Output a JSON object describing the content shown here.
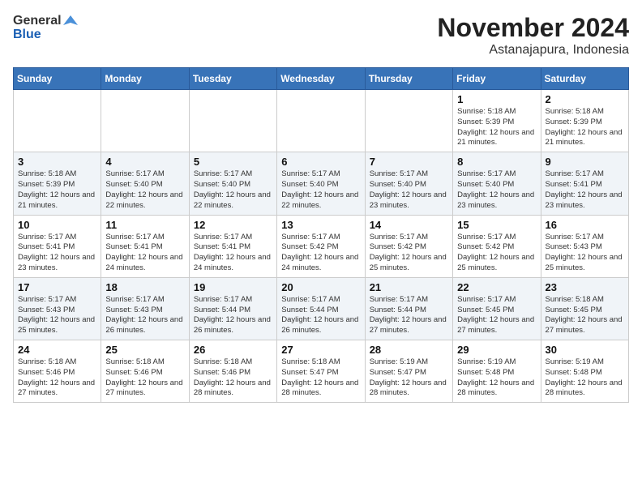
{
  "header": {
    "logo_general": "General",
    "logo_blue": "Blue",
    "title": "November 2024",
    "subtitle": "Astanajapura, Indonesia"
  },
  "calendar": {
    "days_of_week": [
      "Sunday",
      "Monday",
      "Tuesday",
      "Wednesday",
      "Thursday",
      "Friday",
      "Saturday"
    ],
    "weeks": [
      [
        {
          "day": "",
          "info": ""
        },
        {
          "day": "",
          "info": ""
        },
        {
          "day": "",
          "info": ""
        },
        {
          "day": "",
          "info": ""
        },
        {
          "day": "",
          "info": ""
        },
        {
          "day": "1",
          "info": "Sunrise: 5:18 AM\nSunset: 5:39 PM\nDaylight: 12 hours and 21 minutes."
        },
        {
          "day": "2",
          "info": "Sunrise: 5:18 AM\nSunset: 5:39 PM\nDaylight: 12 hours and 21 minutes."
        }
      ],
      [
        {
          "day": "3",
          "info": "Sunrise: 5:18 AM\nSunset: 5:39 PM\nDaylight: 12 hours and 21 minutes."
        },
        {
          "day": "4",
          "info": "Sunrise: 5:17 AM\nSunset: 5:40 PM\nDaylight: 12 hours and 22 minutes."
        },
        {
          "day": "5",
          "info": "Sunrise: 5:17 AM\nSunset: 5:40 PM\nDaylight: 12 hours and 22 minutes."
        },
        {
          "day": "6",
          "info": "Sunrise: 5:17 AM\nSunset: 5:40 PM\nDaylight: 12 hours and 22 minutes."
        },
        {
          "day": "7",
          "info": "Sunrise: 5:17 AM\nSunset: 5:40 PM\nDaylight: 12 hours and 23 minutes."
        },
        {
          "day": "8",
          "info": "Sunrise: 5:17 AM\nSunset: 5:40 PM\nDaylight: 12 hours and 23 minutes."
        },
        {
          "day": "9",
          "info": "Sunrise: 5:17 AM\nSunset: 5:41 PM\nDaylight: 12 hours and 23 minutes."
        }
      ],
      [
        {
          "day": "10",
          "info": "Sunrise: 5:17 AM\nSunset: 5:41 PM\nDaylight: 12 hours and 23 minutes."
        },
        {
          "day": "11",
          "info": "Sunrise: 5:17 AM\nSunset: 5:41 PM\nDaylight: 12 hours and 24 minutes."
        },
        {
          "day": "12",
          "info": "Sunrise: 5:17 AM\nSunset: 5:41 PM\nDaylight: 12 hours and 24 minutes."
        },
        {
          "day": "13",
          "info": "Sunrise: 5:17 AM\nSunset: 5:42 PM\nDaylight: 12 hours and 24 minutes."
        },
        {
          "day": "14",
          "info": "Sunrise: 5:17 AM\nSunset: 5:42 PM\nDaylight: 12 hours and 25 minutes."
        },
        {
          "day": "15",
          "info": "Sunrise: 5:17 AM\nSunset: 5:42 PM\nDaylight: 12 hours and 25 minutes."
        },
        {
          "day": "16",
          "info": "Sunrise: 5:17 AM\nSunset: 5:43 PM\nDaylight: 12 hours and 25 minutes."
        }
      ],
      [
        {
          "day": "17",
          "info": "Sunrise: 5:17 AM\nSunset: 5:43 PM\nDaylight: 12 hours and 25 minutes."
        },
        {
          "day": "18",
          "info": "Sunrise: 5:17 AM\nSunset: 5:43 PM\nDaylight: 12 hours and 26 minutes."
        },
        {
          "day": "19",
          "info": "Sunrise: 5:17 AM\nSunset: 5:44 PM\nDaylight: 12 hours and 26 minutes."
        },
        {
          "day": "20",
          "info": "Sunrise: 5:17 AM\nSunset: 5:44 PM\nDaylight: 12 hours and 26 minutes."
        },
        {
          "day": "21",
          "info": "Sunrise: 5:17 AM\nSunset: 5:44 PM\nDaylight: 12 hours and 27 minutes."
        },
        {
          "day": "22",
          "info": "Sunrise: 5:17 AM\nSunset: 5:45 PM\nDaylight: 12 hours and 27 minutes."
        },
        {
          "day": "23",
          "info": "Sunrise: 5:18 AM\nSunset: 5:45 PM\nDaylight: 12 hours and 27 minutes."
        }
      ],
      [
        {
          "day": "24",
          "info": "Sunrise: 5:18 AM\nSunset: 5:46 PM\nDaylight: 12 hours and 27 minutes."
        },
        {
          "day": "25",
          "info": "Sunrise: 5:18 AM\nSunset: 5:46 PM\nDaylight: 12 hours and 27 minutes."
        },
        {
          "day": "26",
          "info": "Sunrise: 5:18 AM\nSunset: 5:46 PM\nDaylight: 12 hours and 28 minutes."
        },
        {
          "day": "27",
          "info": "Sunrise: 5:18 AM\nSunset: 5:47 PM\nDaylight: 12 hours and 28 minutes."
        },
        {
          "day": "28",
          "info": "Sunrise: 5:19 AM\nSunset: 5:47 PM\nDaylight: 12 hours and 28 minutes."
        },
        {
          "day": "29",
          "info": "Sunrise: 5:19 AM\nSunset: 5:48 PM\nDaylight: 12 hours and 28 minutes."
        },
        {
          "day": "30",
          "info": "Sunrise: 5:19 AM\nSunset: 5:48 PM\nDaylight: 12 hours and 28 minutes."
        }
      ]
    ]
  }
}
